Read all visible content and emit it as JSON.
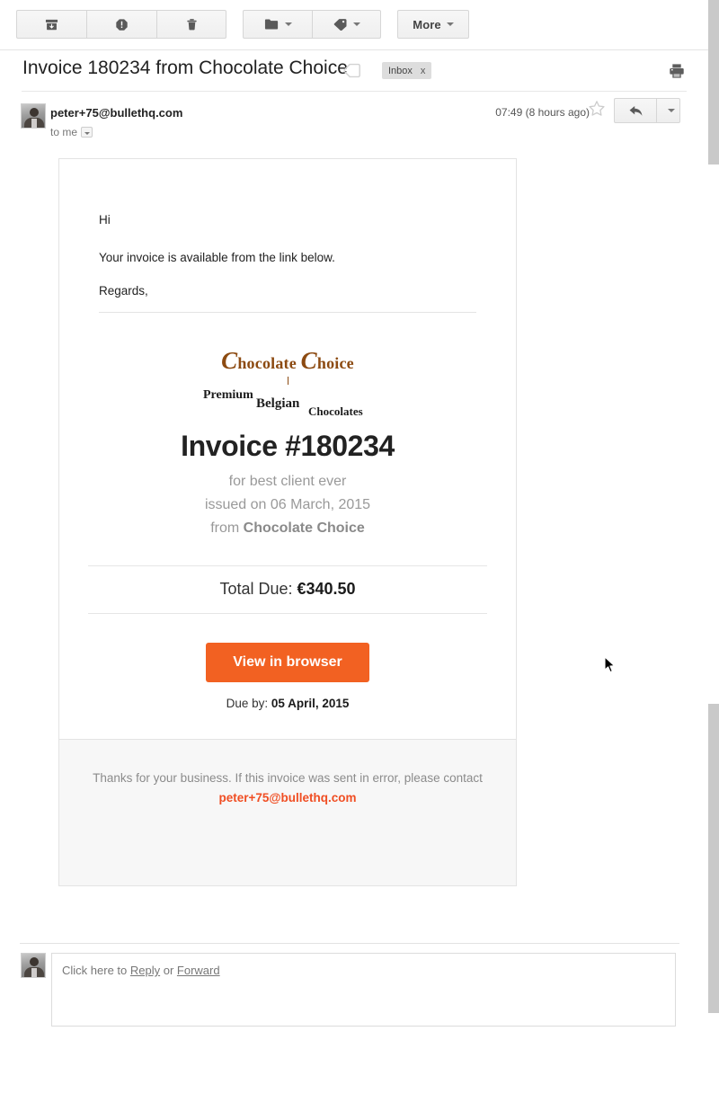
{
  "toolbar": {
    "buttons": [
      {
        "name": "archive",
        "icon": "archive-icon"
      },
      {
        "name": "spam",
        "icon": "report-spam-icon"
      },
      {
        "name": "delete",
        "icon": "trash-icon"
      },
      {
        "name": "move-to",
        "icon": "folder-icon"
      },
      {
        "name": "labels",
        "icon": "label-tag-icon"
      }
    ],
    "more_label": "More"
  },
  "header": {
    "subject": "Invoice 180234 from Chocolate Choice",
    "label_chip": "Inbox",
    "label_chip_remove": "x",
    "print_icon": "print-icon"
  },
  "sender": {
    "email": "peter+75@bullethq.com",
    "recipient": "to me",
    "timestamp": "07:49 (8 hours ago)",
    "star_icon": "star-outline-icon",
    "reply_icon": "reply-arrow-icon",
    "more_icon": "chevron-down-icon"
  },
  "email": {
    "greeting": "Hi",
    "body_line": "Your invoice is available from the link below.",
    "signoff": "Regards,",
    "logo": {
      "brand_c1": "C",
      "brand_word1": "hocolate",
      "brand_c2": "C",
      "brand_word2": "hoice",
      "tagline_1": "Premium",
      "tagline_2": "Belgian",
      "tagline_3": "Chocolates",
      "color": "#8c4a11"
    },
    "invoice": {
      "title": "Invoice #180234",
      "for_line": "for best client ever",
      "issued_line": "issued on 06 March, 2015",
      "from_prefix": "from ",
      "from_company": "Chocolate Choice",
      "total_label": "Total Due: ",
      "total_amount": "€340.50",
      "cta_label": "View in browser",
      "cta_color": "#f26122",
      "due_label": "Due by: ",
      "due_date": "05 April, 2015"
    },
    "footer": {
      "text": "Thanks for your business. If this invoice was sent in error, please contact ",
      "contact_email": "peter+75@bullethq.com",
      "link_color": "#f04e23"
    }
  },
  "reply": {
    "prefix": "Click here to ",
    "reply_link": "Reply",
    "middle": " or ",
    "forward_link": "Forward"
  }
}
